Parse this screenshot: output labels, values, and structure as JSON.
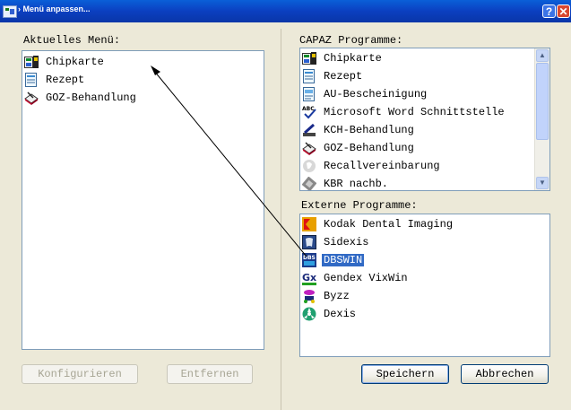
{
  "window": {
    "title": "› Menü anpassen..."
  },
  "left": {
    "label": "Aktuelles Menü:",
    "items": [
      {
        "label": "Chipkarte",
        "icon": "chipcard-icon"
      },
      {
        "label": "Rezept",
        "icon": "prescription-icon"
      },
      {
        "label": "GOZ-Behandlung",
        "icon": "treatment-icon"
      }
    ],
    "configure_label": "Konfigurieren",
    "remove_label": "Entfernen"
  },
  "capaz": {
    "label": "CAPAZ Programme:",
    "items": [
      {
        "label": "Chipkarte",
        "icon": "chipcard-icon"
      },
      {
        "label": "Rezept",
        "icon": "prescription-icon"
      },
      {
        "label": "AU-Bescheinigung",
        "icon": "certificate-icon"
      },
      {
        "label": "Microsoft Word Schnittstelle",
        "icon": "abc-spellcheck-icon"
      },
      {
        "label": "KCH-Behandlung",
        "icon": "pen-icon"
      },
      {
        "label": "GOZ-Behandlung",
        "icon": "treatment-icon"
      },
      {
        "label": "Recallvereinbarung",
        "icon": "recall-icon"
      },
      {
        "label": "KBR nachb.",
        "icon": "tooth-icon"
      }
    ]
  },
  "external": {
    "label": "Externe Programme:",
    "items": [
      {
        "label": "Kodak Dental Imaging",
        "icon": "kodak-icon"
      },
      {
        "label": "Sidexis",
        "icon": "xray-icon"
      },
      {
        "label": "DBSWIN",
        "icon": "dbswin-icon",
        "selected": true
      },
      {
        "label": "Gendex VixWin",
        "icon": "gendex-icon"
      },
      {
        "label": "Byzz",
        "icon": "byzz-icon"
      },
      {
        "label": "Dexis",
        "icon": "dexis-icon"
      }
    ]
  },
  "buttons": {
    "save_label": "Speichern",
    "cancel_label": "Abbrechen"
  },
  "colors": {
    "selection": "#316ac5",
    "title_bar": "#0b3fc0",
    "arrow": "#000000"
  }
}
